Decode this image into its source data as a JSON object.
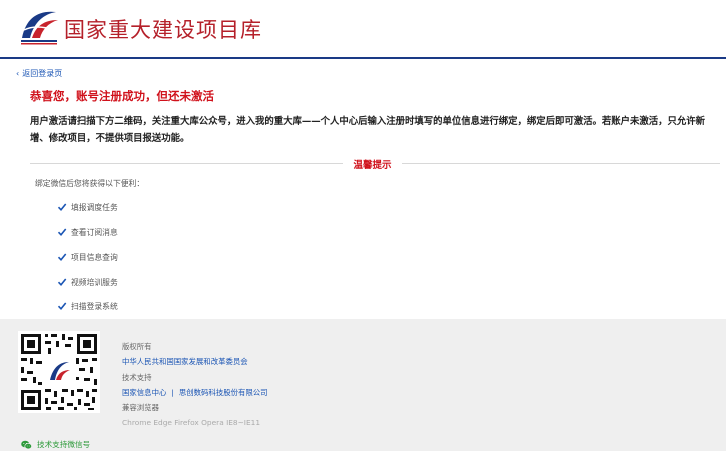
{
  "header": {
    "title": "国家重大建设项目库"
  },
  "nav": {
    "back_label": "返回登录页"
  },
  "message": {
    "success_title": "恭喜您，账号注册成功，但还未激活",
    "instructions": "用户激活请扫描下方二维码，关注重大库公众号，进入我的重大库——个人中心后输入注册时填写的单位信息进行绑定，绑定后即可激活。若账户未激活，只允许新增、修改项目，不提供项目报送功能。"
  },
  "tips": {
    "title": "温馨提示",
    "intro": "绑定微信后您将获得以下便利：",
    "benefits": [
      "填报调度任务",
      "查看订阅消息",
      "项目信息查询",
      "视频培训服务",
      "扫描登录系统"
    ]
  },
  "footer": {
    "copyright_label": "版权所有",
    "copyright_owner": "中华人民共和国国家发展和改革委员会",
    "support_label": "技术支持",
    "support_org_1": "国家信息中心",
    "support_sep": "|",
    "support_org_2": "思创数码科技股份有限公司",
    "browser_label": "兼容浏览器",
    "browser_list": "Chrome Edge Firefox Opera IE8~IE11",
    "wechat_label": "技术支持微信号"
  },
  "icons": {
    "logo": "project-library-logo",
    "back": "chevron-left-icon",
    "check": "checkbox-checked-icon",
    "qr": "qr-code",
    "wechat": "wechat-icon"
  },
  "colors": {
    "brand_red": "#d0111b",
    "brand_blue": "#1a3a86",
    "link_blue": "#1b55b4",
    "wechat_green": "#2d9a3a"
  }
}
